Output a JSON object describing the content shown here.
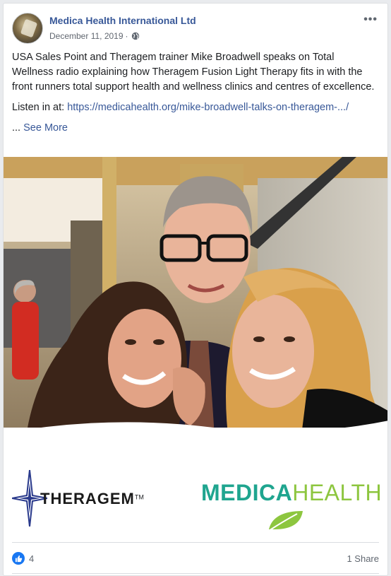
{
  "post": {
    "page_name": "Medica Health International Ltd",
    "date": "December 11, 2019",
    "separator": "·",
    "more_label": "•••",
    "body": "USA Sales Point and Theragem trainer Mike Broadwell speaks on Total Wellness radio explaining how Theragem Fusion Light Therapy fits in with the front runners total support health and wellness clinics and centres of excellence.",
    "listen_prefix": "Listen in at: ",
    "link_text": "https://medicahealth.org/mike-broadwell-talks-on-theragem-.../",
    "ellipsis": "... ",
    "see_more": "See More"
  },
  "banner": {
    "theragem": "THERAGEM",
    "theragem_tm": "TM",
    "medica": "MEDICA",
    "health": "HEALTH"
  },
  "footer": {
    "like_count": "4",
    "share_label": "1 Share"
  },
  "colors": {
    "link": "#385898",
    "like_blue": "#1877f2",
    "medica_teal": "#1fa58f",
    "health_green": "#8dc63f"
  },
  "icons": [
    "globe-icon",
    "more-options-icon",
    "like-icon",
    "star-compass-icon",
    "leaf-icon"
  ]
}
